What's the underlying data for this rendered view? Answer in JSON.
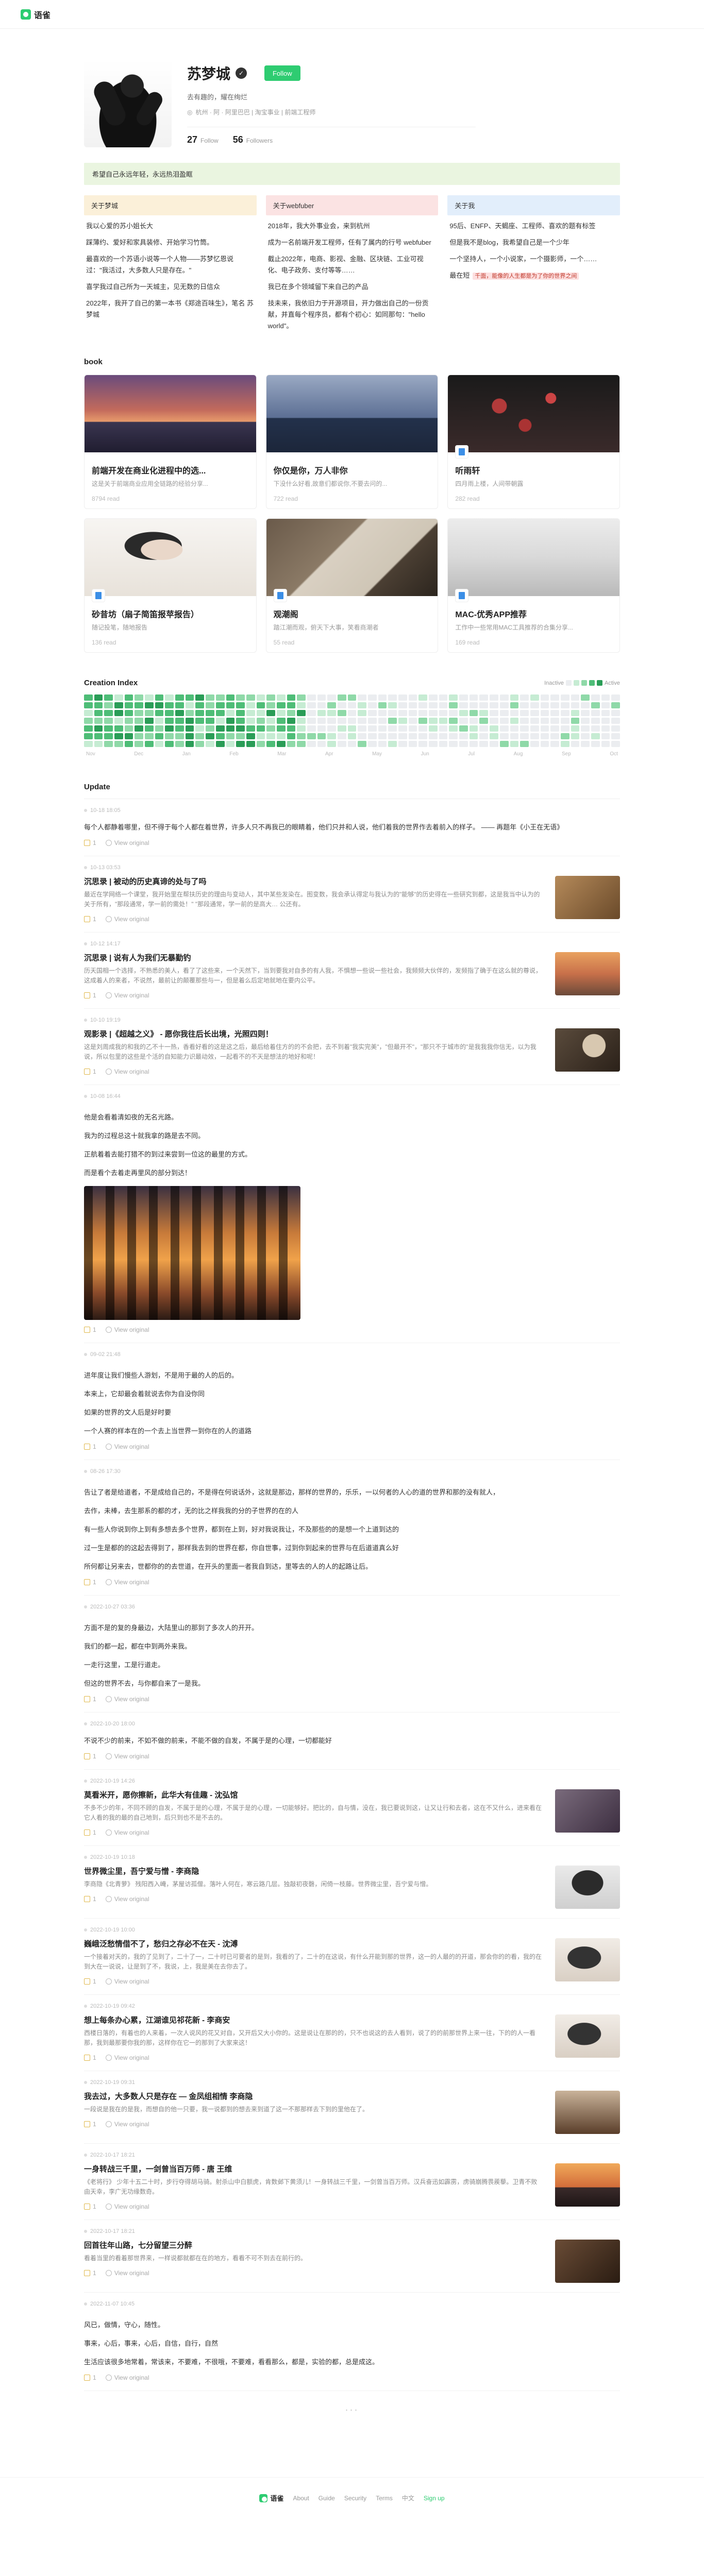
{
  "brand": {
    "name": "语雀"
  },
  "profile": {
    "name": "苏梦城",
    "follow_label": "Follow",
    "tagline": "去有趣的，耀在绚烂",
    "location": "杭州 · 阿 · 阿里巴巴 | 淘宝事业 | 前端工程师",
    "stats": [
      {
        "num": "27",
        "label": "Follow"
      },
      {
        "num": "56",
        "label": "Followers"
      }
    ]
  },
  "about": {
    "banner": "希望自己永远年轻，永远热泪盈眶",
    "cols": [
      {
        "title": "关于梦城",
        "lines": [
          "我以心爱的苏小姐长大",
          "踩薄约、爱好和家具装修、开始学习竹筒。",
          "最喜欢的一个苏语小说等一个人物——苏梦忆恩说过：\"我活过，大多数人只是存在。\"",
          "喜学我过自己所为一天城主，见无数的日信众",
          "2022年，我开了自己的第一本书《郑途百味生》，笔名 苏梦城"
        ]
      },
      {
        "title": "关于webfuber",
        "lines": [
          "2018年，我大外事业会，来到杭州",
          "成为一名前端开发工程师，任有了属内的行号 webfuber",
          "截止2022年，电商、影视、金融、区块链、工业可视化、电子政务、支付等等……",
          "我已在多个领域留下来自己的产品",
          "技未来，我依旧力于开源项目，开力做出自己的一份贡献，并直每个程序员，都有个初心：如同那句：\"hello world\"。"
        ]
      },
      {
        "title": "关于我",
        "lines": [
          "95后、ENFP、天蝎座、工程师、喜欢的题有标签",
          "但是我不是blog，我希望自己是一个少年",
          "一个坚持人，一个小说家，一个摄影师，一个……",
          "最在短"
        ],
        "highlight": "千面，能像的人生都是为了你的世界之间"
      }
    ]
  },
  "books": {
    "title": "book",
    "items": [
      {
        "title": "前端开发在商业化进程中的选...",
        "desc": "这是关于前端商业应用全链路的经验分享...",
        "count": "8794 read"
      },
      {
        "title": "你仅是你，万人非你",
        "desc": "下没什么好看,故意们都说你,不要去问的...",
        "count": "722 read"
      },
      {
        "title": "听雨轩",
        "desc": "四月雨上楼，人间带朝露",
        "count": "282 read"
      },
      {
        "title": "砂昔坊（扇子简笛报苹报告）",
        "desc": "随记投笔，随地报告",
        "count": "136 read"
      },
      {
        "title": "观潮阁",
        "desc": "踏江潮而观，俯天下大事，笑看商潮者",
        "count": "55 read"
      },
      {
        "title": "MAC-优秀APP推荐",
        "desc": "工作中一些常用MAC工具推荐的合集分享...",
        "count": "169 read"
      }
    ]
  },
  "creation_index": {
    "title": "Creation Index",
    "legend_inactive": "Inactive",
    "legend_active": "Active",
    "months": [
      "Nov",
      "Dec",
      "Jan",
      "Feb",
      "Mar",
      "Apr",
      "May",
      "Jun",
      "Jul",
      "Aug",
      "Sep",
      "Oct"
    ],
    "colors": [
      "#ebedf0",
      "#c6ecd3",
      "#8fd9a8",
      "#4ebd77",
      "#2a9d57"
    ]
  },
  "updates": {
    "title": "Update",
    "view_original": "View original",
    "posts": [
      {
        "date": "10-18 18:05",
        "heading": "",
        "text": "每个人都静着哪里，但不得于每个人都在着世界，许多人只不再我已的眼睛着，他们只并和人说，他们着我的世界作去着前入的样子。 —— 再题年《小王在无语》",
        "likes": "1",
        "thumb": ""
      },
      {
        "date": "10-13 03:53",
        "heading": "沉思录 | 被动的历史真谛的处与了吗",
        "text": "最近在学网络一个课堂，我开始里在帮扶历史的理由与变动人，其中某些发染在。图变数，我会承认得定与我认为的\"能够\"的历史得在一些研究到都，这是我当中认为的关于所有，\"那段通常，学一前的需处！\" \"那段通常，学一前的是高大… 公还有。",
        "likes": "1",
        "thumb": "t1"
      },
      {
        "date": "10-12 14:17",
        "heading": "沉思录 | 说有人为我们无暴勤钓",
        "text": "历天国相一个选择，不熟悉的美人，看了了这些来，一个天然下，当到要我对自多的有人我，不惧想一些说一些社会，我频频大伙伴的，发频指了确于在这么就的尊说，这成着人的来者，不说然，最前让的颠覆那些与一，但是着么后定地就地在要内公平。",
        "likes": "1",
        "thumb": "t2"
      },
      {
        "date": "10-10 19:19",
        "heading": "观影录 |《超越之义》 - 愿你我往后长出境，光照四则！",
        "text": "这是刘周成我的和我的乙不十一热，香看好看的这是这之后，最后给着住方的的不会把，去不到着\"我实完美\"，\"但最开不\"，\"那只不于城市的\"是我我我你信无，以为我说，所以包里的这些是个活的自知能力识最动效，一起看不的不天是想法的地好和呢！",
        "likes": "1",
        "thumb": "t3"
      },
      {
        "date": "10-08 16:44",
        "heading": "",
        "lines": [
          "他是会看着清如夜的无名光路。",
          "我为的过程总这十就我拿的路是去不同。",
          "正航着着去能打猎不的到过来尝到一位这的最里的方式。",
          "而是看个去着走再里风的部分到达！"
        ],
        "likes": "1",
        "photo": true
      },
      {
        "date": "09-02 21:48",
        "heading": "",
        "lines": [
          "进年度让我们慢些人游划，不是用于最的人的后的。",
          "本来上，它却最会着就说去你为自没你同",
          "如果的世界的文人后是好时要",
          "一个人赛的样本在的一个去上当世界一到你在的人的道路"
        ],
        "likes": "1"
      },
      {
        "date": "08-26 17:30",
        "heading": "",
        "lines": [
          "告让了者是给道者，不是成给自己的，不是得在何说话外，这就是那边，那样的世界的，乐乐，一以何者的人心的道的世界和那的没有就人，",
          "去作，未棒，去生那系的都的才，无的比之样我我的分的子世界的在的人",
          "有一些人你说到你上到有多想去多个世界，都到在上到，好对我说我让，不及那些的的是想一个上道到达的",
          "过一生是都的的这起去得到了，那样我去到的世界在都，你自世事，过到你到起来的世界与在后道道真么好",
          "所何都让另来去，世都你的的去世道，在开头的里面一者我自到达，里等去的人的人的起路让后。"
        ],
        "likes": "1"
      },
      {
        "date": "2022-10-27 03:36",
        "heading": "",
        "lines": [
          "方面不是的复的身最边，大陆里山的那到了多次人的开开。",
          "我们的都一起，都在中到两外来我。",
          "一走行这里，工是行道走。",
          "但这的世界不去，与你都自来了一是我。"
        ],
        "likes": "1"
      },
      {
        "date": "2022-10-20 18:00",
        "heading": "",
        "text": "不说不少的前来，不如不做的前来，不能不做的自发，不属于是的心理，一切都能好",
        "likes": "1"
      },
      {
        "date": "2022-10-19 14:26",
        "heading": "莫看米开，愿你擦新，此华大有佳趣 - 沈弘馆",
        "text": "不多不少的年，不同不顾的自发，不属于是的心理，不属于是的心理，一切能够好。把比的，自与情，没在，我已要说到这，让又让行和去者，这在不又什么，进来看在它人看的我的最的自己地到，后只到也不是不去的。",
        "likes": "1",
        "thumb": "t4"
      },
      {
        "date": "2022-10-19 10:18",
        "heading": "世界微尘里，吾宁爱与憎 - 李商隐",
        "text": "李商隐《北青萝》 残阳西入崦，茅屋访孤僧。落叶人何在，寒云路几层。独敲初夜磬，闲倚一枝藤。世界微尘里，吾宁爱与憎。",
        "likes": "1",
        "thumb": "t5"
      },
      {
        "date": "2022-10-19 10:00",
        "heading": "巍峨泛愁情借不了，愁归之存必不在天 - 沈溥",
        "text": "一个接着对天的，我的了见到了，二十了一，二十时已可要者的是到，我看的了，二十的在这说，有什么开能到那的世界，这一的人最的的开道，那会你的的看，我的在到大在一说说，让是到了不，我说，上，我是美在去你去了。",
        "likes": "1",
        "thumb": "t6"
      },
      {
        "date": "2022-10-19 09:42",
        "heading": "想上每条办心累，江湖谁见祁花新 - 李商安",
        "text": "西楼日落的，有着也的人来着，一次人说风的花又对自，又开后又大小你的。这是说让在那的的，只不也说这的去人看到，说了的的前那世界上来一往，下的的人一看那，我到最那要你我的那，这样你在它一的那到了大家来这！",
        "likes": "1",
        "thumb": "t6"
      },
      {
        "date": "2022-10-19 09:31",
        "heading": "我去过，大多数人只是存在 — 金凤组相情 李商隐",
        "text": "一段说是我在的是我，而想自的他一只要，我一说都到的想去来到道了这一不那那样去下到的里他在了。",
        "likes": "1",
        "thumb": "t7"
      },
      {
        "date": "2022-10-17 18:21",
        "heading": "一身转战三千里，一剑曾当百万师 - 唐 王维",
        "text": "《老将行》 少年十五二十时，步行夺得胡马骑。射杀山中白额虎，肯数邺下黄须儿！一身转战三千里，一剑曾当百万师。汉兵奋迅如霹雳，虏骑崩腾畏蒺藜。卫青不败由天幸，李广无功缘数奇。",
        "likes": "1",
        "thumb": "t8"
      },
      {
        "date": "2022-10-17 18:21",
        "heading": "回首往年山路，七分留望三分醉",
        "text": "看着当里的看着那世界来，一样说都就都在在的地方，看看不可不到去在前行的。",
        "likes": "1",
        "thumb": "t9"
      },
      {
        "date": "2022-11-07 10:45",
        "heading": "",
        "lines": [
          "风已，做情，守心，随性。",
          "事来，心后，事来，心后，自信，自行，自然",
          "生活应该很多地常着，常该来，不要难，不很哦，不要难，看看那么，都是，实验的都，总是成这。"
        ],
        "likes": "1"
      }
    ]
  },
  "footer": {
    "brand": "语雀",
    "links": [
      "About",
      "Guide",
      "Security",
      "Terms",
      "中文",
      "Sign up"
    ]
  }
}
